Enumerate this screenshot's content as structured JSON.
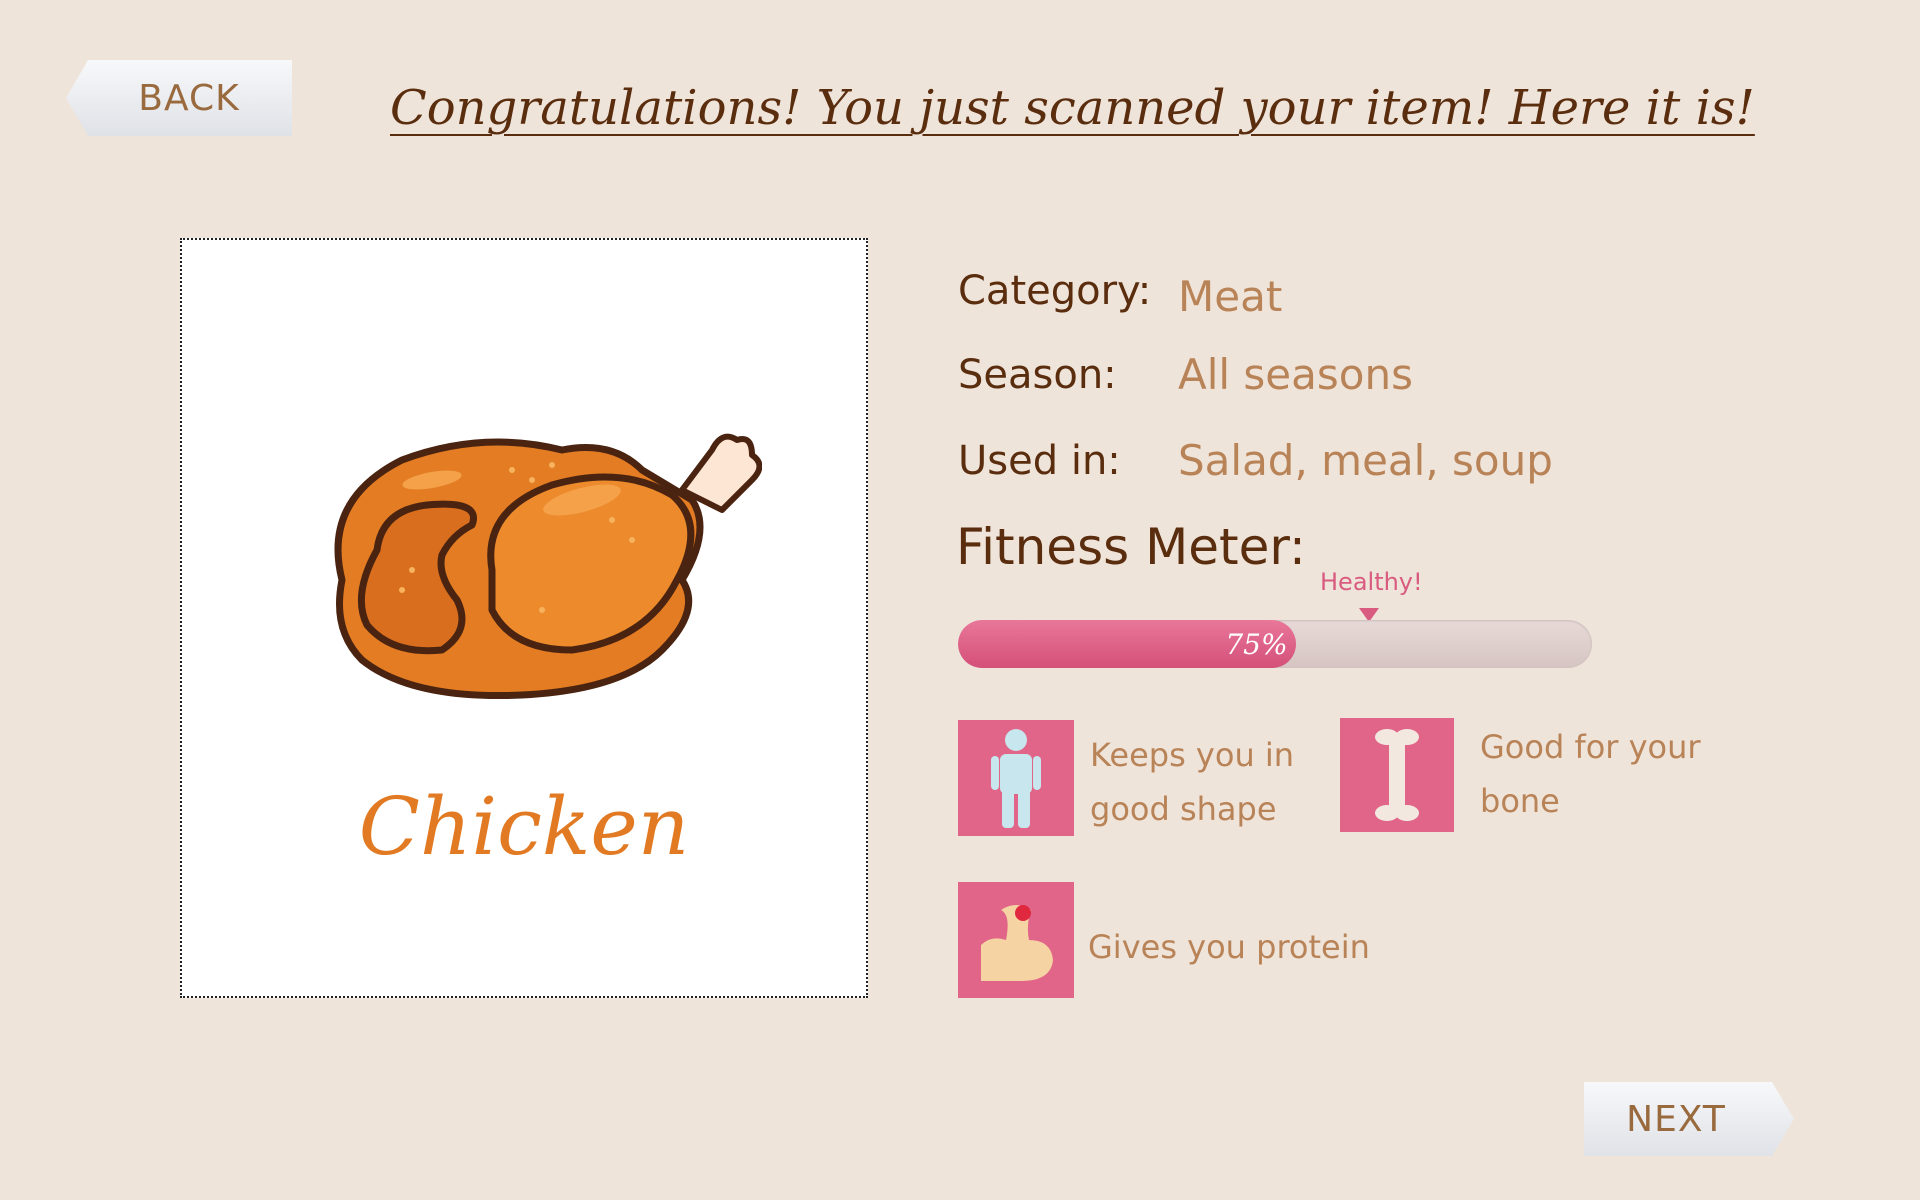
{
  "nav": {
    "back_label": "BACK",
    "next_label": "NEXT"
  },
  "header": {
    "title": "Congratulations! You just scanned your item! Here it is!"
  },
  "item": {
    "name": "Chicken",
    "image_icon": "roast-chicken-illustration"
  },
  "info": {
    "category_label": "Category:",
    "category_value": "Meat",
    "season_label": "Season:",
    "season_value": "All seasons",
    "used_in_label": "Used in:",
    "used_in_value": "Salad, meal, soup"
  },
  "fitness": {
    "title": "Fitness Meter:",
    "value_percent": 75,
    "value_label": "75%",
    "marker_label": "Healthy!"
  },
  "benefits": [
    {
      "icon": "person-icon",
      "line1": "Keeps you in",
      "line2": "good shape"
    },
    {
      "icon": "bone-icon",
      "line1": "Good for your",
      "line2": "bone"
    },
    {
      "icon": "muscle-arm-icon",
      "line1": "Gives you protein",
      "line2": ""
    }
  ],
  "colors": {
    "background": "#efe4da",
    "title_brown": "#5a2d0e",
    "value_tan": "#b98358",
    "accent_pink": "#e06588",
    "chicken_orange": "#e27a23"
  }
}
